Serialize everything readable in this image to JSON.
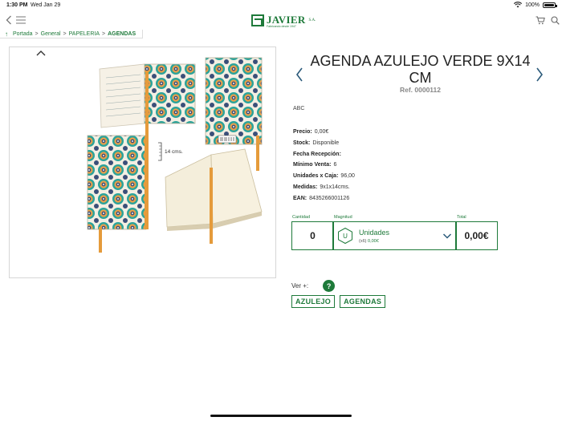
{
  "status_bar": {
    "time": "1:30 PM",
    "date": "Wed Jan 29",
    "battery": "100%"
  },
  "nav": {
    "logo_text": "JAVIER",
    "logo_suffix": "S.A.",
    "logo_tagline": "Fabricando desde 1947",
    "icons": [
      "back-icon",
      "menu-icon",
      "cart-icon",
      "search-icon"
    ]
  },
  "breadcrumb": {
    "items": [
      "Portada",
      "General",
      "PAPELERIA"
    ],
    "current": "AGENDAS",
    "separator": ">"
  },
  "product": {
    "title": "AGENDA AZULEJO VERDE 9X14 CM",
    "ref": "Ref. 0000112",
    "description": "ABC",
    "image_caption": "14 cms.",
    "details": [
      {
        "label": "Precio:",
        "value": "0,00€"
      },
      {
        "label": "Stock:",
        "value": "Disponible"
      },
      {
        "label": "Fecha Recepción:",
        "value": ""
      },
      {
        "label": "Mínimo Venta:",
        "value": "6"
      },
      {
        "label": "Unidades x Caja:",
        "value": "96,00"
      },
      {
        "label": "Medidas:",
        "value": "9x1x14cms."
      },
      {
        "label": "EAN:",
        "value": "8435266001126"
      }
    ]
  },
  "order": {
    "headers": {
      "quantity": "Cantidad",
      "magnitude": "Magnitud",
      "total": "Total"
    },
    "quantity": "0",
    "unit_icon": "U",
    "unit_name": "Unidades",
    "unit_multiplier": "(x6)",
    "unit_price": "0,00€",
    "total": "0,00€"
  },
  "see_more": {
    "label": "Ver +:",
    "button": "?"
  },
  "tags": [
    "AZULEJO",
    "AGENDAS"
  ],
  "colors": {
    "brand_green": "#1e7a3a",
    "title_text": "#222222",
    "ref_gray": "#888888"
  }
}
